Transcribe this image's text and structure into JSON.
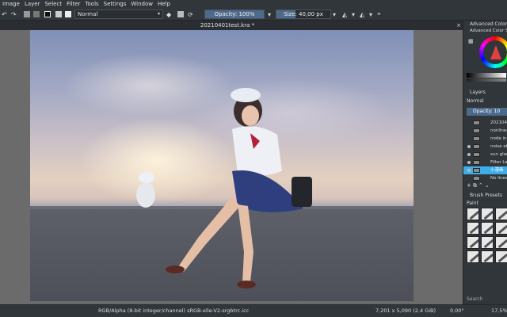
{
  "menu": [
    "Image",
    "Layer",
    "Select",
    "Filter",
    "Tools",
    "Settings",
    "Window",
    "Help"
  ],
  "toolbar": {
    "blend_mode": "Normal",
    "opacity_label": "Opacity: 100%",
    "opacity_value": 1.0,
    "size_label": "Size: 40,00 px",
    "size_fill": 0.35
  },
  "document": {
    "tab_title": "20210401test.kra *",
    "close_glyph": "×"
  },
  "dock": {
    "color_title": "Advanced Color Selector",
    "layers_title": "Layers",
    "blend_mode": "Normal",
    "opacity_label": "Opacity: 10",
    "layers": [
      {
        "name": "20210401",
        "active": false
      },
      {
        "name": "nonlinear",
        "active": false
      },
      {
        "name": "node in p",
        "active": false
      },
      {
        "name": "noise eff",
        "active": false
      },
      {
        "name": "sun glare",
        "active": false
      },
      {
        "name": "Filter Lay",
        "active": false
      },
      {
        "name": "小漫画",
        "active": true
      },
      {
        "name": "No lines",
        "active": false
      }
    ],
    "brush_title": "Brush Presets",
    "brush_tag": "Paint",
    "search_label": "Search"
  },
  "status": {
    "color_space": "RGB/Alpha (8-bit integer/channel)  sRGB-elle-V2-srgbtrc.icc",
    "dimensions": "7,201 x 5,090 (2,4 GiB)",
    "rotation": "0,00°",
    "zoom": "17,5%"
  },
  "icons": {
    "undo": "↶",
    "redo": "↷",
    "eraser": "◆",
    "reset": "⟳",
    "mirror": "◭",
    "wrap": "⌖",
    "dropdown": "▾"
  }
}
